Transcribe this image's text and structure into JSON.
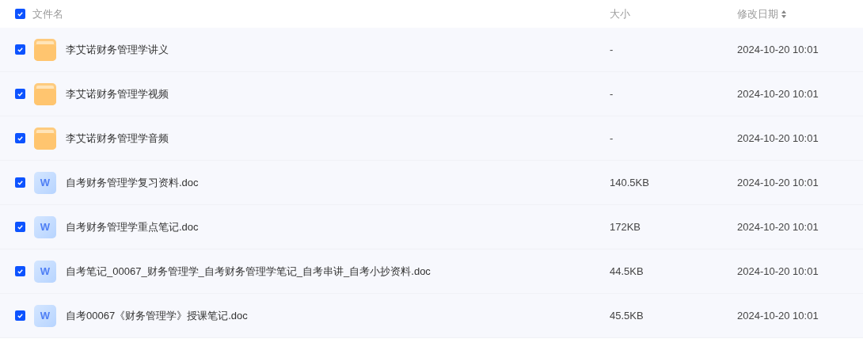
{
  "header": {
    "checked": true,
    "columns": [
      "文件名",
      "大小",
      "修改日期"
    ]
  },
  "rows": [
    {
      "kind": "folder",
      "checked": true,
      "name": "李艾诺财务管理学讲义",
      "size": "-",
      "modified": "2024-10-20 10:01"
    },
    {
      "kind": "folder",
      "checked": true,
      "name": "李艾诺财务管理学视频",
      "size": "-",
      "modified": "2024-10-20 10:01"
    },
    {
      "kind": "folder",
      "checked": true,
      "name": "李艾诺财务管理学音频",
      "size": "-",
      "modified": "2024-10-20 10:01"
    },
    {
      "kind": "doc",
      "icon_letter": "W",
      "checked": true,
      "name": "自考财务管理学复习资料.doc",
      "size": "140.5KB",
      "modified": "2024-10-20 10:01"
    },
    {
      "kind": "doc",
      "icon_letter": "W",
      "checked": true,
      "name": "自考财务管理学重点笔记.doc",
      "size": "172KB",
      "modified": "2024-10-20 10:01"
    },
    {
      "kind": "doc",
      "icon_letter": "W",
      "checked": true,
      "name": "自考笔记_00067_财务管理学_自考财务管理学笔记_自考串讲_自考小抄资料.doc",
      "size": "44.5KB",
      "modified": "2024-10-20 10:01"
    },
    {
      "kind": "doc",
      "icon_letter": "W",
      "checked": true,
      "name": "自考00067《财务管理学》授课笔记.doc",
      "size": "45.5KB",
      "modified": "2024-10-20 10:01"
    }
  ]
}
